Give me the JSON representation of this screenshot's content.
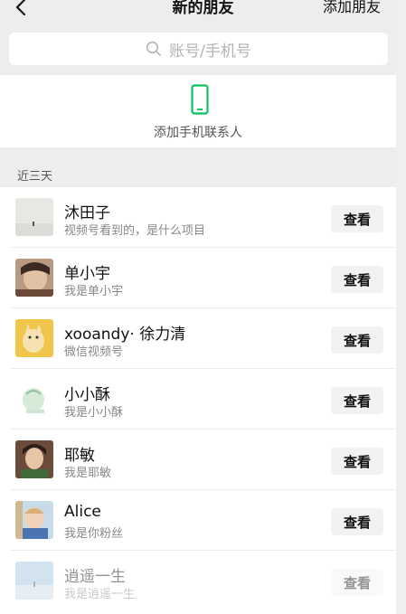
{
  "nav": {
    "title": "新的朋友",
    "action_label": "添加朋友"
  },
  "search": {
    "placeholder": "账号/手机号"
  },
  "add_contacts": {
    "label": "添加手机联系人"
  },
  "section": {
    "label": "近三天"
  },
  "requests": [
    {
      "name": "沐田子",
      "message": "视频号看到的，是什么项目",
      "button": "查看"
    },
    {
      "name": "单小宇",
      "message": "我是单小宇",
      "button": "查看"
    },
    {
      "name": "xooandy· 徐力清",
      "message": "微信视频号",
      "button": "查看"
    },
    {
      "name": "小小酥",
      "message": "我是小小酥",
      "button": "查看"
    },
    {
      "name": "耶敏",
      "message": "我是耶敏",
      "button": "查看"
    },
    {
      "name": "Alice",
      "message": "我是你粉丝",
      "button": "查看"
    },
    {
      "name": "逍遥一生",
      "message": "我是逍遥一生",
      "button": "查看"
    }
  ],
  "colors": {
    "background": "#ededed",
    "accent_green": "#07c160",
    "button_bg": "#f2f2f2"
  },
  "icons": {
    "back": "chevron-left-icon",
    "search": "search-icon",
    "phone": "phone-icon"
  }
}
